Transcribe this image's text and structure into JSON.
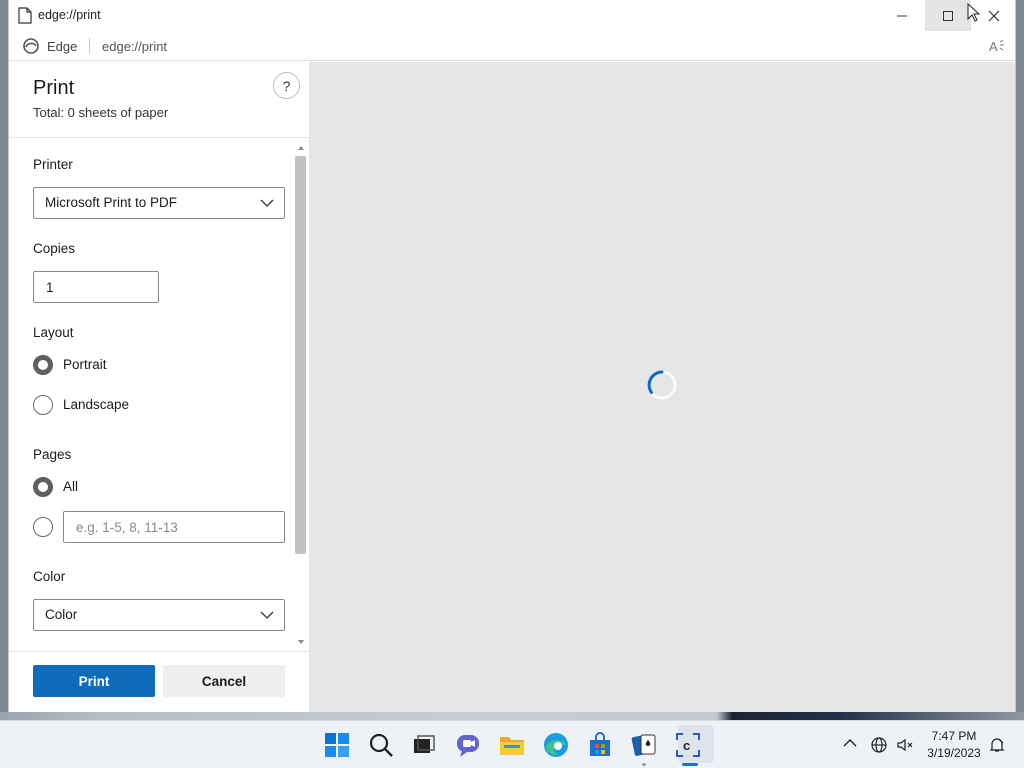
{
  "window": {
    "tab_title": "edge://print",
    "brand": "Edge",
    "url": "edge://print"
  },
  "print_panel": {
    "title": "Print",
    "total": "Total: 0 sheets of paper",
    "help_icon": "?",
    "printer": {
      "label": "Printer",
      "value": "Microsoft Print to PDF"
    },
    "copies": {
      "label": "Copies",
      "value": "1"
    },
    "layout": {
      "label": "Layout",
      "options": [
        {
          "label": "Portrait",
          "selected": true
        },
        {
          "label": "Landscape",
          "selected": false
        }
      ]
    },
    "pages": {
      "label": "Pages",
      "options": [
        {
          "label": "All",
          "selected": true
        },
        {
          "label": "",
          "selected": false
        }
      ],
      "custom_placeholder": "e.g. 1-5, 8, 11-13"
    },
    "color": {
      "label": "Color",
      "value": "Color"
    },
    "print_button": "Print",
    "cancel_button": "Cancel"
  },
  "preview": {
    "state": "loading"
  },
  "taskbar": {
    "apps": [
      {
        "name": "start",
        "icon": "windows-logo-icon"
      },
      {
        "name": "search",
        "icon": "search-icon"
      },
      {
        "name": "task-view",
        "icon": "task-view-icon"
      },
      {
        "name": "chat",
        "icon": "chat-icon"
      },
      {
        "name": "file-explorer",
        "icon": "folder-icon"
      },
      {
        "name": "edge",
        "icon": "edge-icon"
      },
      {
        "name": "store",
        "icon": "store-icon"
      },
      {
        "name": "solitaire",
        "icon": "cards-icon"
      },
      {
        "name": "app",
        "icon": "c-app-icon",
        "active": true
      }
    ],
    "time": "7:47 PM",
    "date": "3/19/2023"
  },
  "colors": {
    "accent": "#0f6cbd",
    "preview_bg": "#e6e6e6",
    "taskbar_bg": "#eef1f6"
  }
}
